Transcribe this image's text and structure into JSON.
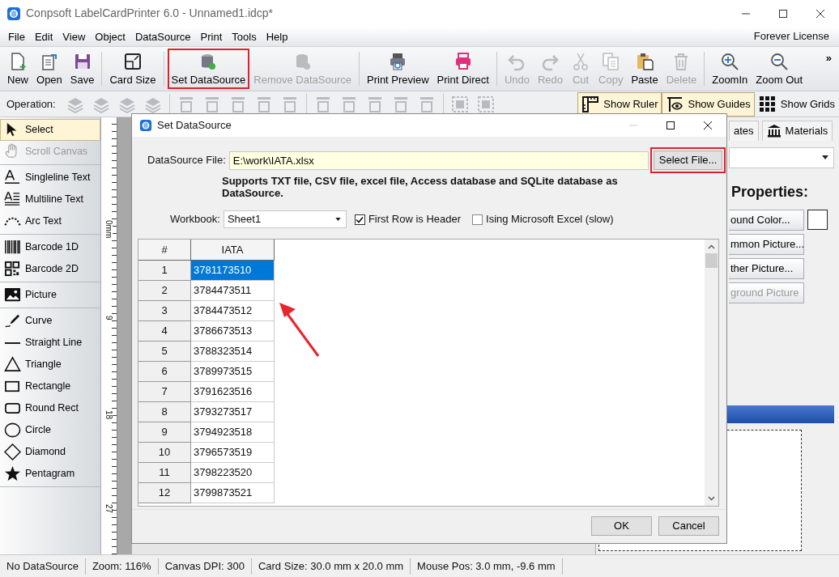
{
  "window": {
    "title": "Conpsoft LabelCardPrinter 6.0 - Unnamed1.idcp*"
  },
  "menu": [
    "File",
    "Edit",
    "View",
    "Object",
    "DataSource",
    "Print",
    "Tools",
    "Help"
  ],
  "license": "Forever License",
  "toolbar_groups": [
    {
      "items": [
        {
          "label": "New",
          "disabled": false,
          "highlighted": false
        },
        {
          "label": "Open",
          "disabled": false,
          "highlighted": false
        },
        {
          "label": "Save",
          "disabled": false,
          "highlighted": false
        }
      ]
    },
    {
      "items": [
        {
          "label": "Card Size",
          "disabled": false,
          "highlighted": false
        }
      ]
    },
    {
      "items": [
        {
          "label": "Set DataSource",
          "disabled": false,
          "highlighted": true
        },
        {
          "label": "Remove DataSource",
          "disabled": true,
          "highlighted": false
        }
      ]
    },
    {
      "items": [
        {
          "label": "Print Preview",
          "disabled": false,
          "highlighted": false
        },
        {
          "label": "Print Direct",
          "disabled": false,
          "highlighted": false
        }
      ]
    },
    {
      "items": [
        {
          "label": "Undo",
          "disabled": true,
          "highlighted": false
        },
        {
          "label": "Redo",
          "disabled": true,
          "highlighted": false
        },
        {
          "label": "Cut",
          "disabled": true,
          "highlighted": false
        },
        {
          "label": "Copy",
          "disabled": true,
          "highlighted": false
        },
        {
          "label": "Paste",
          "disabled": false,
          "highlighted": false
        },
        {
          "label": "Delete",
          "disabled": true,
          "highlighted": false
        }
      ]
    },
    {
      "items": [
        {
          "label": "ZoomIn",
          "disabled": false,
          "highlighted": false
        },
        {
          "label": "Zoom Out",
          "disabled": false,
          "highlighted": false
        }
      ]
    }
  ],
  "toolbar_more": "»",
  "operation": {
    "label": "Operation:",
    "button_groups": [
      {
        "buttons": [
          {
            "disabled": true
          },
          {
            "disabled": true
          },
          {
            "disabled": true
          },
          {
            "disabled": true
          }
        ]
      },
      {
        "buttons": [
          {
            "disabled": true
          },
          {
            "disabled": true
          },
          {
            "disabled": true
          },
          {
            "disabled": true
          },
          {
            "disabled": true
          }
        ]
      },
      {
        "buttons": [
          {
            "disabled": true
          },
          {
            "disabled": true
          },
          {
            "disabled": true
          },
          {
            "disabled": true
          },
          {
            "disabled": true
          }
        ]
      },
      {
        "buttons": [
          {
            "disabled": true
          },
          {
            "disabled": true
          }
        ]
      }
    ]
  },
  "view_toggles": [
    {
      "label": "Show Ruler",
      "on": true
    },
    {
      "label": "Show Guides",
      "on": true
    },
    {
      "label": "Show Grids",
      "on": false
    }
  ],
  "tool_groups": [
    {
      "items": [
        {
          "label": "Select",
          "selected": true,
          "disabled": false
        },
        {
          "label": "Scroll Canvas",
          "selected": false,
          "disabled": true
        }
      ]
    },
    {
      "items": [
        {
          "label": "Singleline Text",
          "selected": false,
          "disabled": false
        },
        {
          "label": "Multiline Text",
          "selected": false,
          "disabled": false
        },
        {
          "label": "Arc Text",
          "selected": false,
          "disabled": false
        }
      ]
    },
    {
      "items": [
        {
          "label": "Barcode 1D",
          "selected": false,
          "disabled": false
        },
        {
          "label": "Barcode 2D",
          "selected": false,
          "disabled": false
        }
      ]
    },
    {
      "items": [
        {
          "label": "Picture",
          "selected": false,
          "disabled": false
        }
      ]
    },
    {
      "items": [
        {
          "label": "Curve",
          "selected": false,
          "disabled": false
        },
        {
          "label": "Straight Line",
          "selected": false,
          "disabled": false
        },
        {
          "label": "Triangle",
          "selected": false,
          "disabled": false
        },
        {
          "label": "Rectangle",
          "selected": false,
          "disabled": false
        },
        {
          "label": "Round Rect",
          "selected": false,
          "disabled": false
        },
        {
          "label": "Circle",
          "selected": false,
          "disabled": false
        },
        {
          "label": "Diamond",
          "selected": false,
          "disabled": false
        },
        {
          "label": "Pentagram",
          "selected": false,
          "disabled": false
        }
      ]
    }
  ],
  "ruler": {
    "labels": [
      "0mm",
      "9",
      "18",
      "27"
    ]
  },
  "right_panel": {
    "tabs": [
      "ates",
      "Materials"
    ],
    "heading": "Properties:",
    "buttons": [
      {
        "label": "ound Color...",
        "disabled": false
      },
      {
        "label": "mmon Picture...",
        "disabled": false
      },
      {
        "label": "ther Picture...",
        "disabled": false
      },
      {
        "label": "ground Picture",
        "disabled": true
      }
    ]
  },
  "dialog": {
    "title": "Set DataSource",
    "file_label": "DataSource File:",
    "file_value": "E:\\work\\IATA.xlsx",
    "select_button": {
      "label": "Select File...",
      "highlighted": true
    },
    "note": "Supports TXT file, CSV file, excel file, Access database and SQLite database as DataSource.",
    "workbook_label": "Workbook:",
    "workbook_value": "Sheet1",
    "options": [
      {
        "label": "First Row is Header",
        "checked": true
      },
      {
        "label": "Ising Microsoft Excel (slow)",
        "checked": false
      }
    ],
    "table": {
      "columns": [
        "#",
        "IATA"
      ],
      "rows": [
        {
          "num": "1",
          "iata": "3781173510",
          "selected": true
        },
        {
          "num": "2",
          "iata": "3784473511",
          "selected": false
        },
        {
          "num": "3",
          "iata": "3784473512",
          "selected": false
        },
        {
          "num": "4",
          "iata": "3786673513",
          "selected": false
        },
        {
          "num": "5",
          "iata": "3788323514",
          "selected": false
        },
        {
          "num": "6",
          "iata": "3789973515",
          "selected": false
        },
        {
          "num": "7",
          "iata": "3791623516",
          "selected": false
        },
        {
          "num": "8",
          "iata": "3793273517",
          "selected": false
        },
        {
          "num": "9",
          "iata": "3794923518",
          "selected": false
        },
        {
          "num": "10",
          "iata": "3796573519",
          "selected": false
        },
        {
          "num": "11",
          "iata": "3798223520",
          "selected": false
        },
        {
          "num": "12",
          "iata": "3799873521",
          "selected": false
        }
      ]
    },
    "buttons": [
      "OK",
      "Cancel"
    ]
  },
  "status_bar": [
    "No DataSource",
    "Zoom: 116%",
    "Canvas DPI: 300",
    "Card Size: 30.0 mm x 20.0 mm",
    "Mouse Pos: 3.0 mm, -9.6 mm"
  ]
}
